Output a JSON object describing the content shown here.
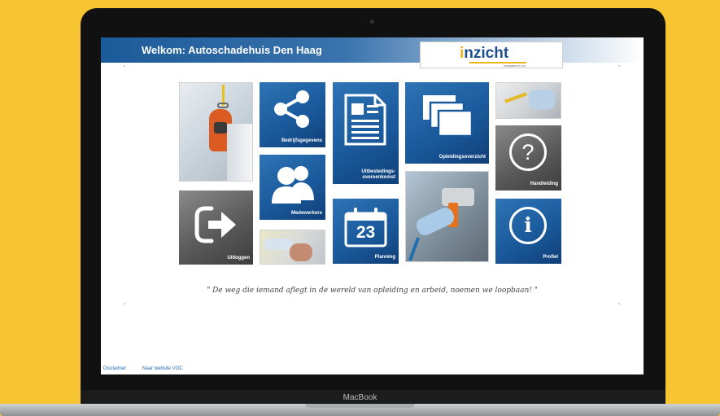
{
  "header": {
    "welcome": "Welkom: Autoschadehuis Den Haag",
    "logo_i": "i",
    "logo_rest": "nzicht",
    "logo_sub": "POWERED BY VOC"
  },
  "tiles": {
    "bedrijfsgegevens": "Bedrijfsgegevens",
    "medewerkers": "Medewerkers",
    "uitbesteding": "Uitbestedings-overeenkomst",
    "planning": "Planning",
    "planning_date": "23",
    "opleidingsoverzicht": "Opleidingsoverzicht",
    "handleiding": "Handleiding",
    "profiel": "Profiel",
    "uitloggen": "Uitloggen"
  },
  "quote": "\" De weg die iemand aflegt in de wereld van opleiding en arbeid, noemen we loopbaan! \"",
  "footer": {
    "disclaimer": "Disclaimer",
    "website": "Naar website VOC"
  },
  "device": {
    "brand": "MacBook"
  },
  "colors": {
    "background": "#f7c531",
    "tile_blue": "#1a5a9c",
    "tile_gray": "#5a5a5a"
  }
}
